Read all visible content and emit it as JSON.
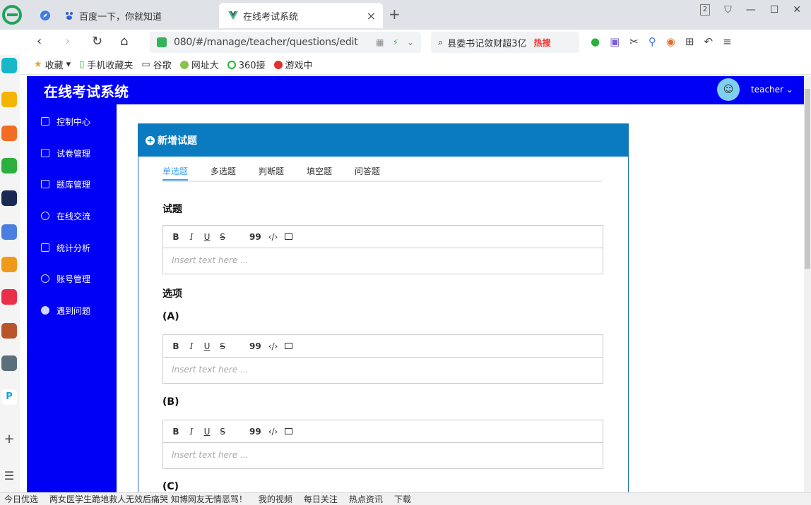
{
  "browser": {
    "tabs": [
      {
        "label": ""
      },
      {
        "label": "百度一下，你就知道"
      },
      {
        "label": "在线考试系统"
      }
    ],
    "tab_close": "×",
    "new_tab": "+",
    "window_badge": "2",
    "back": "‹",
    "forward": "›",
    "reload": "↻",
    "home": "⌂",
    "url": "080/#/manage/teacher/questions/edit",
    "search_text": "县委书记敛财超3亿",
    "hot_tag": "热搜",
    "bookmarks": [
      "收藏",
      "手机收藏夹",
      "谷歌",
      "网址大",
      "360接",
      "游戏中"
    ],
    "status_items": [
      "今日优选",
      "两女医学生跪地救人无效后痛哭 知博网友无情恶骂！",
      "我的视频",
      "每日关注",
      "热点资讯",
      "下载"
    ]
  },
  "app": {
    "title": "在线考试系统",
    "user": "teacher ⌄",
    "avatar_glyph": "☺"
  },
  "menu": [
    {
      "label": "控制中心"
    },
    {
      "label": "试卷管理"
    },
    {
      "label": "题库管理"
    },
    {
      "label": "在线交流"
    },
    {
      "label": "统计分析"
    },
    {
      "label": "账号管理"
    },
    {
      "label": "遇到问题"
    }
  ],
  "form": {
    "header": "新增试题",
    "question_types": [
      "单选题",
      "多选题",
      "判断题",
      "填空题",
      "问答题"
    ],
    "question_label": "试题",
    "options_label": "选项",
    "option_a": "(A)",
    "option_b": "(B)",
    "option_c": "(C)",
    "editor_placeholder": "Insert text here ...",
    "toolbar": {
      "bold": "B",
      "italic": "I",
      "underline": "U",
      "strike": "S",
      "quote": "99",
      "code": "‹/›"
    }
  },
  "colors": {
    "app_blue": "#0000f5",
    "card_header": "#0a7bc0",
    "tab_active": "#409eff"
  }
}
